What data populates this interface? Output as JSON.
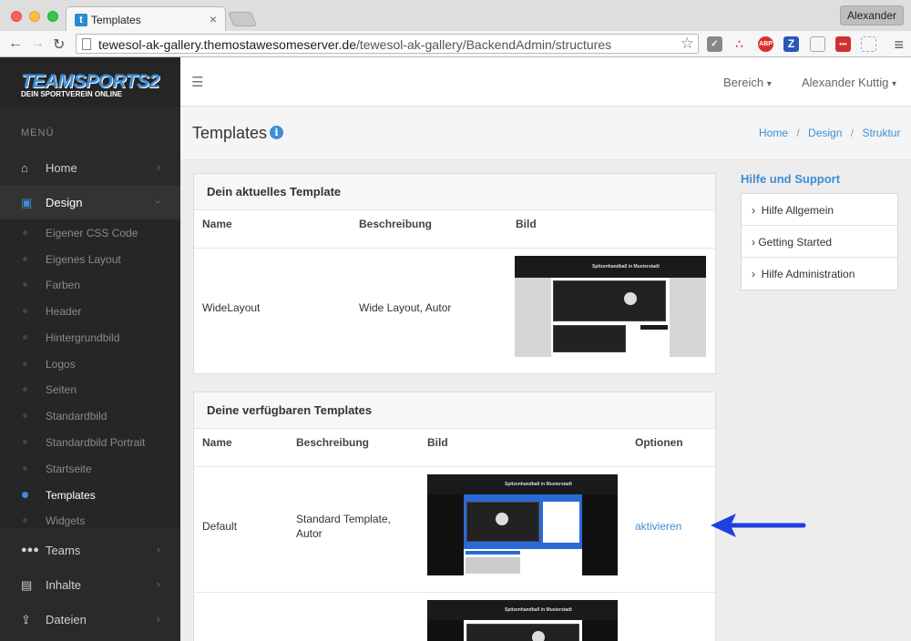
{
  "browser": {
    "tab_title": "Templates",
    "tab_favicon": "t",
    "tab_close": "×",
    "profile_name": "Alexander",
    "url_host": "tewesol-ak-gallery.themostawesomeserver.de",
    "url_path": "/tewesol-ak-gallery/BackendAdmin/structures",
    "extensions": [
      "ABP",
      "Z",
      "•••"
    ]
  },
  "sidebar": {
    "logo_main": "TEAMSPORTS2",
    "logo_sub": "DEIN SPORTVEREIN ONLINE",
    "menu_label": "MENÜ",
    "items": [
      {
        "label": "Home",
        "icon": "home-icon"
      },
      {
        "label": "Design",
        "icon": "picture-icon"
      },
      {
        "label": "Teams",
        "icon": "group-icon"
      },
      {
        "label": "Inhalte",
        "icon": "document-icon"
      },
      {
        "label": "Dateien",
        "icon": "upload-icon"
      }
    ],
    "design_subitems": [
      "Eigener CSS Code",
      "Eigenes Layout",
      "Farben",
      "Header",
      "Hintergrundbild",
      "Logos",
      "Seiten",
      "Standardbild",
      "Standardbild Portrait",
      "Startseite",
      "Templates",
      "Widgets"
    ],
    "current_subitem": "Templates"
  },
  "header": {
    "bereich": "Bereich",
    "user": "Alexander Kuttig",
    "caret": "▾"
  },
  "page": {
    "title": "Templates",
    "info_glyph": "i",
    "breadcrumb": [
      "Home",
      "Design",
      "Struktur"
    ],
    "breadcrumb_sep": "/"
  },
  "current_template": {
    "panel_title": "Dein aktuelles Template",
    "columns": [
      "Name",
      "Beschreibung",
      "Bild"
    ],
    "row": {
      "name": "WideLayout",
      "description": "Wide Layout, Autor"
    }
  },
  "available_templates": {
    "panel_title": "Deine verfügbaren Templates",
    "columns": [
      "Name",
      "Beschreibung",
      "Bild",
      "Optionen"
    ],
    "rows": [
      {
        "name": "Default",
        "description_line1": "Standard Template,",
        "description_line2": "Autor",
        "option": "aktivieren"
      }
    ]
  },
  "thumbnail": {
    "banner_text": "Spitzenhandball in Musterstadt"
  },
  "support": {
    "title": "Hilfe und Support",
    "items": [
      "Hilfe Allgemein",
      "Getting Started",
      "Hilfe Administration"
    ]
  },
  "colors": {
    "accent": "#3d8ed5",
    "arrow": "#1f3fe0",
    "sidebar_bg": "#2a2a2a"
  }
}
